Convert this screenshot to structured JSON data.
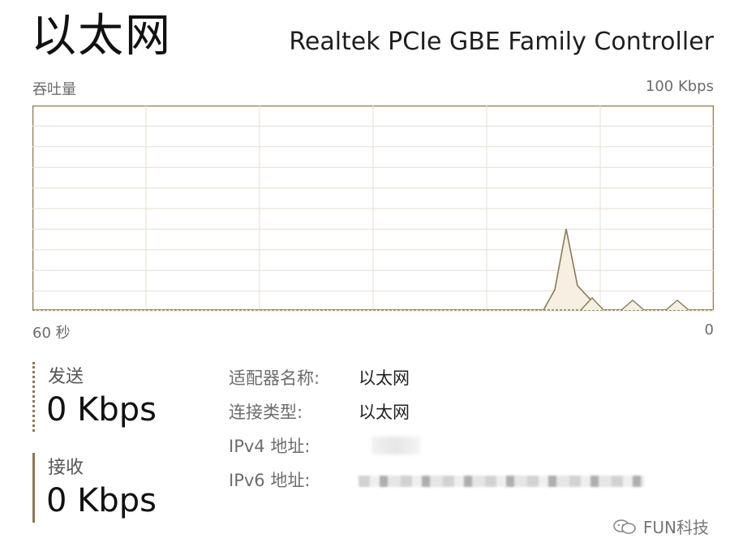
{
  "header": {
    "title": "以太网",
    "adapter_name": "Realtek PCIe GBE Family Controller"
  },
  "graph": {
    "label_left": "吞吐量",
    "label_right": "100 Kbps",
    "time_left": "60 秒",
    "time_right": "0",
    "line_color": "#8a7a55",
    "fill_color": "#f6efe2",
    "grid_color": "#e6dfcf",
    "throughput_series": {
      "x_seconds_ago": [
        60,
        50,
        40,
        30,
        20,
        16,
        15,
        14,
        13,
        12,
        11,
        10,
        8,
        6,
        5,
        4,
        3,
        2,
        1,
        0
      ],
      "send_kbps": [
        0,
        0,
        0,
        0,
        0,
        0,
        0,
        0,
        0,
        0,
        0,
        0,
        0,
        0,
        0,
        0,
        0,
        0,
        0,
        0
      ],
      "receive_kbps": [
        0,
        0,
        0,
        0,
        0,
        0,
        0,
        10,
        40,
        12,
        6,
        0,
        0,
        0,
        0,
        0,
        0,
        0,
        0,
        0
      ]
    }
  },
  "stats": {
    "send_label": "发送",
    "send_value": "0 Kbps",
    "receive_label": "接收",
    "receive_value": "0 Kbps"
  },
  "properties": [
    {
      "key": "适配器名称:",
      "value": "以太网"
    },
    {
      "key": "连接类型:",
      "value": "以太网"
    },
    {
      "key": "IPv4 地址:",
      "value": ""
    },
    {
      "key": "IPv6 地址:",
      "value": ""
    }
  ],
  "watermark": {
    "text": "FUN科技",
    "icon": "chat-bubble-icon"
  }
}
